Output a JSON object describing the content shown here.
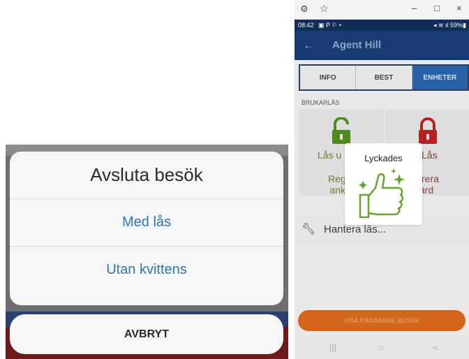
{
  "action_sheet": {
    "title": "Avsluta besök",
    "options": [
      {
        "label": "Med lås"
      },
      {
        "label": "Utan kvittens"
      }
    ],
    "cancel_label": "AVBRYT"
  },
  "window": {
    "controls": [
      "–",
      "□",
      "×"
    ]
  },
  "status_bar": {
    "time": "08:42",
    "battery": "59%"
  },
  "app_bar": {
    "title": "Agent Hill",
    "back_icon": "arrow-left-icon"
  },
  "tabs": [
    {
      "label": "INFO",
      "active": false
    },
    {
      "label": "BEST",
      "active": false
    },
    {
      "label": "ENHETER",
      "active": true
    }
  ],
  "section_label": "BRUKARLÅS",
  "lock_cards": {
    "left": {
      "label": "Lås u",
      "action": "Regist\nankor"
    },
    "right": {
      "label": "Lås",
      "action": "istrera\nvfärd"
    }
  },
  "manage": {
    "label": "Hantera lås..."
  },
  "toast": {
    "text": "Lyckades",
    "icon": "thumbs-up-icon"
  },
  "visit_button": {
    "label": "VISA PÅGÅENDE BESÖK"
  },
  "nav_bar": [
    "|||",
    "○",
    "<"
  ],
  "colors": {
    "header": "#173c73",
    "tab_active": "#2560a8",
    "accent_orange": "#d2661a",
    "lock_green": "#4f8a1e",
    "lock_red": "#b52222",
    "option_blue": "#2c78b4"
  }
}
